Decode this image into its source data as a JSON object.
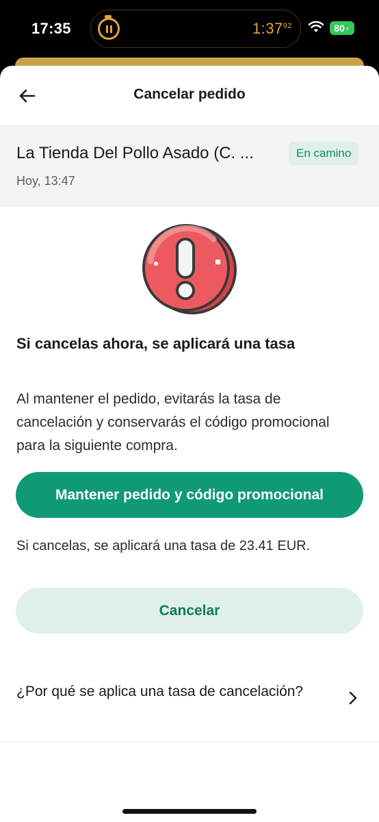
{
  "status_bar": {
    "time": "17:35",
    "timer_main": "1:37",
    "timer_fraction": "92",
    "battery": "80",
    "timer_icon": "pause-timer-icon",
    "wifi_icon": "wifi-icon",
    "accent_color": "#e7a235",
    "battery_color": "#34c759"
  },
  "header": {
    "title": "Cancelar pedido",
    "back_icon": "arrow-left-icon"
  },
  "order": {
    "store_name": "La Tienda Del Pollo Asado (C. ...",
    "status": "En camino",
    "time": "Hoy, 13:47"
  },
  "content": {
    "icon": "exclamation-alert-icon",
    "heading": "Si cancelas ahora, se aplicará una tasa",
    "description": "Al mantener el pedido, evitarás la tasa de cancelación y conservarás el código promocional para la siguiente compra.",
    "keep_button": "Mantener pedido y código promocional",
    "fee_text": "Si cancelas, se aplicará una tasa de 23.41 EUR.",
    "cancel_button": "Cancelar",
    "faq_text": "¿Por qué se aplica una tasa de cancelación?",
    "faq_icon": "chevron-right-icon"
  },
  "colors": {
    "primary": "#0f9a74",
    "primary_light": "#dff0ea",
    "alert_red": "#ec5a5f"
  }
}
